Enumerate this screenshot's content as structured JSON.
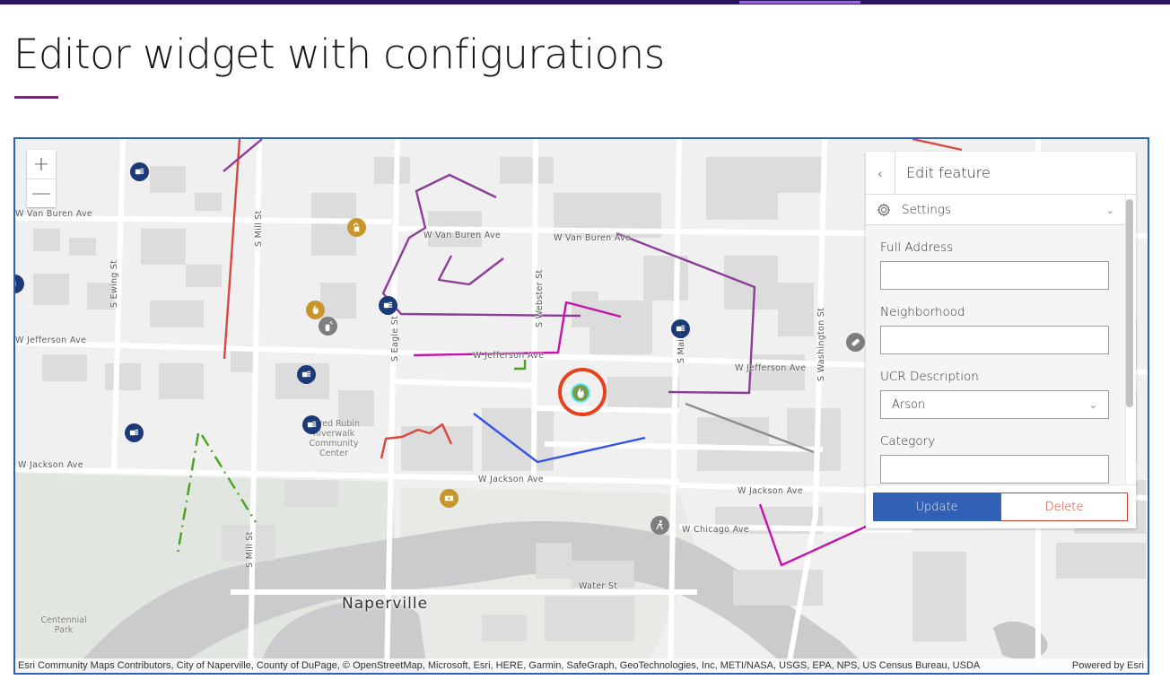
{
  "page": {
    "title": "Editor widget with configurations"
  },
  "colors": {
    "topbar": "#2a1560",
    "topbar_active": "#a35ef0",
    "title_accent": "#8a1b8f",
    "map_border": "#2c62b9",
    "update_button": "#3161b6",
    "delete_button": "#c7412c",
    "selection_ring": "#e8401c"
  },
  "map": {
    "zoom_in_label": "+",
    "zoom_out_label": "—",
    "city_label": "Naperville",
    "road_labels": {
      "van_buren_west": "W Van Buren Ave",
      "van_buren_mid": "W Van Buren Ave",
      "van_buren_east": "W Van Buren Ave",
      "jefferson_west": "W Jefferson Ave",
      "jefferson_mid": "W Jefferson Ave",
      "jefferson_east": "W Jefferson Ave",
      "jackson_west": "W Jackson Ave",
      "jackson_mid": "W Jackson Ave",
      "jackson_east": "W Jackson Ave",
      "chicago": "W Chicago Ave",
      "water": "Water St",
      "ewing": "S Ewing St",
      "mill_north": "S Mill St",
      "mill_south": "S Mill St",
      "eagle": "S Eagle St",
      "webster": "S Webster St",
      "main": "S Main St",
      "washington": "S Washington St"
    },
    "place_labels": {
      "community_center": "Alfred Rubin\nRiverwalk\nCommunity\nCenter",
      "park": "Centennial\nPark"
    },
    "poi_icons": [
      {
        "name": "assault-icon",
        "color": "navy"
      },
      {
        "name": "assault-icon",
        "color": "navy"
      },
      {
        "name": "assault-icon",
        "color": "navy"
      },
      {
        "name": "assault-icon",
        "color": "navy"
      },
      {
        "name": "assault-icon",
        "color": "navy"
      },
      {
        "name": "assault-icon",
        "color": "navy"
      },
      {
        "name": "theft-icon",
        "color": "gold"
      },
      {
        "name": "arson-icon",
        "color": "gold"
      },
      {
        "name": "vandalism-spray-icon",
        "color": "gray"
      },
      {
        "name": "drug-pill-icon",
        "color": "gray"
      },
      {
        "name": "pedestrian-icon",
        "color": "gray"
      },
      {
        "name": "ticket-fraud-icon",
        "color": "gold"
      }
    ],
    "selected_feature": {
      "icon": "arson-icon",
      "color": "#7a9a4a",
      "highlight": "#5ff0f0"
    },
    "attribution": "Esri Community Maps Contributors, City of Naperville, County of DuPage, © OpenStreetMap, Microsoft, Esri, HERE, Garmin, SafeGraph, GeoTechnologies, Inc, METI/NASA, USGS, EPA, NPS, US Census Bureau, USDA",
    "powered_by": "Powered by Esri"
  },
  "editor": {
    "title": "Edit feature",
    "back_icon": "‹",
    "settings_label": "Settings",
    "fields": [
      {
        "label": "Full Address",
        "value": "",
        "type": "text"
      },
      {
        "label": "Neighborhood",
        "value": "",
        "type": "text"
      },
      {
        "label": "UCR Description",
        "value": "Arson",
        "type": "select"
      },
      {
        "label": "Category",
        "value": "",
        "type": "text"
      }
    ],
    "update_label": "Update",
    "delete_label": "Delete"
  }
}
